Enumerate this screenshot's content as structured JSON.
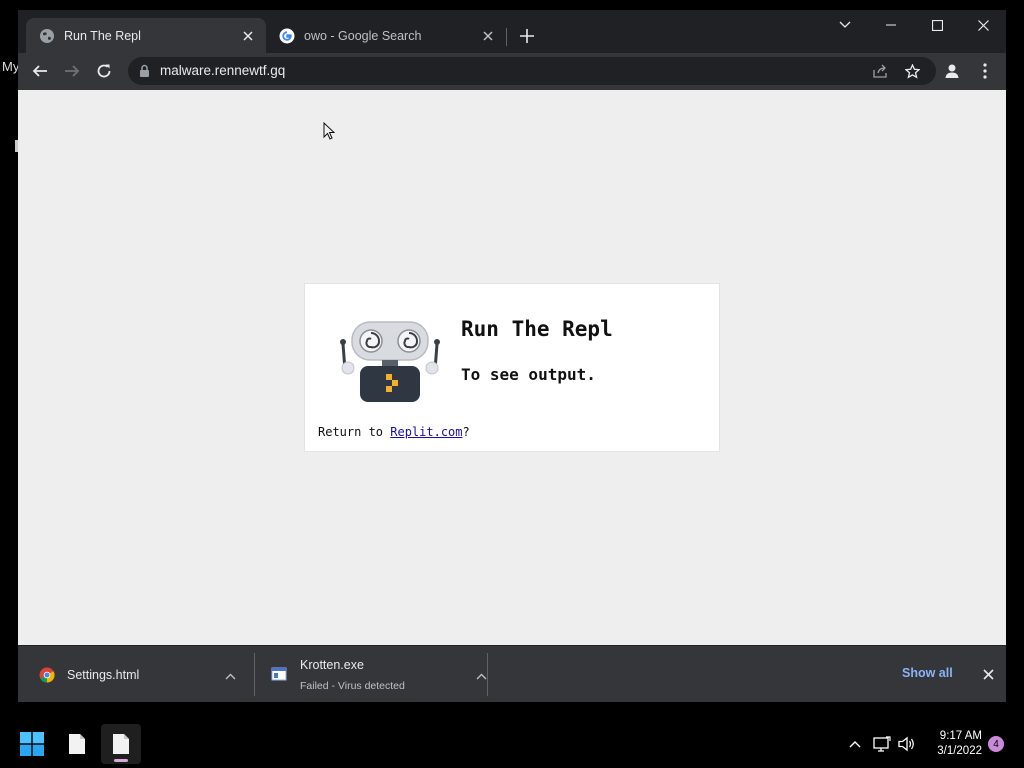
{
  "desktop": {
    "partial_text": "My"
  },
  "browser": {
    "tabs": [
      {
        "title": "Run The Repl",
        "active": true,
        "favicon": "globe-icon"
      },
      {
        "title": "owo - Google Search",
        "active": false,
        "favicon": "google-icon"
      }
    ],
    "url": "malware.rennewtf.gq"
  },
  "page": {
    "heading": "Run The Repl",
    "subheading": "To see output.",
    "return_prefix": "Return to ",
    "return_link": "Replit.com",
    "return_suffix": "?"
  },
  "downloads": {
    "items": [
      {
        "name": "Settings.html",
        "status": "",
        "icon": "chrome-icon"
      },
      {
        "name": "Krotten.exe",
        "status": "Failed - Virus detected",
        "icon": "exe-file-icon"
      }
    ],
    "show_all_label": "Show all"
  },
  "taskbar": {
    "time": "9:17 AM",
    "date": "3/1/2022",
    "notification_count": "4"
  },
  "colors": {
    "link": "#1a0dab",
    "show_all": "#8ab4f8",
    "accent_notif": "#c98bd9"
  }
}
